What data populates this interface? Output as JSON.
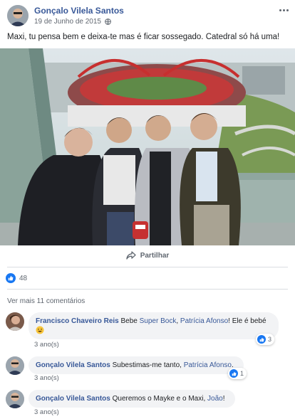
{
  "post": {
    "author": "Gonçalo Vilela Santos",
    "date": "19 de Junho de 2015",
    "privacy_icon": "globe-icon",
    "text": "Maxi, tu pensa bem e deixa-te mas é ficar sossegado. Catedral só há uma!",
    "share_label": "Partilhar",
    "like_count": "48"
  },
  "comments_section": {
    "view_more": "Ver mais 11 comentários",
    "comments": [
      {
        "author": "Francisco Chaveiro Reis",
        "text_before": " Bebe ",
        "link1": "Super Bock",
        "text_mid": ", ",
        "link2": "Patrícia Afonso",
        "text_after": "! Ele é bebé ",
        "time": "3 ano(s)",
        "reactions": "3"
      },
      {
        "author": "Gonçalo Vilela Santos",
        "text_before": " Subestimas-me tanto, ",
        "link1": "Patrícia Afonso",
        "text_after": ".",
        "time": "3 ano(s)",
        "reactions": "1"
      },
      {
        "author": "Gonçalo Vilela Santos",
        "text_before": " Queremos o Mayke e o Maxi, ",
        "link1": "João",
        "text_after": "!",
        "time": "3 ano(s)"
      }
    ]
  },
  "colors": {
    "link": "#385898",
    "like_blue": "#1877f2",
    "bubble_bg": "#f2f3f5",
    "muted": "#606770"
  }
}
